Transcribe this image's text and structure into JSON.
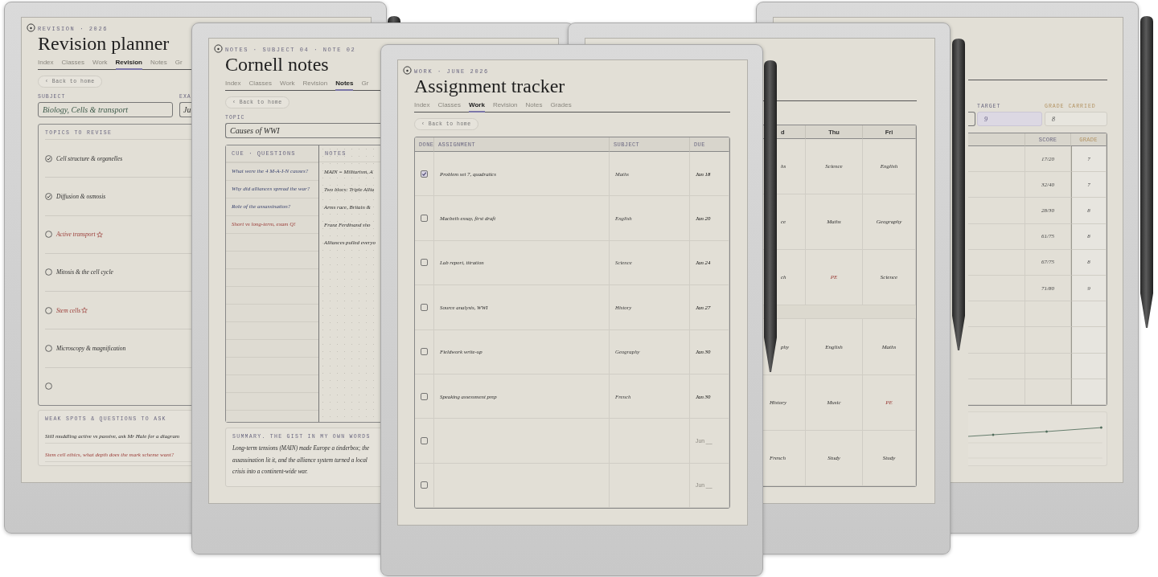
{
  "devices": [
    {
      "kind": "revision",
      "eyebrow": "REVISION · 2026",
      "title": "Revision planner",
      "tabs": [
        {
          "label": "Index",
          "selected": false
        },
        {
          "label": "Classes",
          "selected": false
        },
        {
          "label": "Work",
          "selected": false
        },
        {
          "label": "Revision",
          "selected": true
        },
        {
          "label": "Notes",
          "selected": false
        },
        {
          "label": "Gr",
          "selected": false
        }
      ],
      "back_button": "‹ Back to home",
      "subject": {
        "label": "SUBJECT",
        "value": "Biology, Cells & transport"
      },
      "exam": {
        "label": "EXA",
        "value": "Ju"
      },
      "topics_title": "TOPICS TO REVISE",
      "topics": [
        {
          "text": "Cell structure & organelles",
          "checked": true,
          "starred": false
        },
        {
          "text": "Diffusion & osmosis",
          "checked": true,
          "starred": false
        },
        {
          "text": "Active transport",
          "checked": false,
          "starred": true
        },
        {
          "text": "Mitosis & the cell cycle",
          "checked": false,
          "starred": false
        },
        {
          "text": "Stem cells",
          "checked": false,
          "starred": true
        },
        {
          "text": "Microscopy & magnification",
          "checked": false,
          "starred": false
        },
        {
          "checked": false,
          "starred": false
        }
      ],
      "weak_title": "WEAK SPOTS & QUESTIONS TO ASK",
      "weak_notes": [
        {
          "text": "Still muddling active vs passive, ask Mr Hale for a diagram",
          "flagged": false
        },
        {
          "text": "Stem cell ethics, what depth does the mark scheme want?",
          "flagged": true
        }
      ]
    },
    {
      "kind": "cornell",
      "eyebrow": "NOTES · SUBJECT 04 · NOTE 02",
      "title": "Cornell notes",
      "tabs": [
        {
          "label": "Index",
          "selected": false
        },
        {
          "label": "Classes",
          "selected": false
        },
        {
          "label": "Work",
          "selected": false
        },
        {
          "label": "Revision",
          "selected": false
        },
        {
          "label": "Notes",
          "selected": true
        },
        {
          "label": "Gr",
          "selected": false
        }
      ],
      "back_button": "‹ Back to home",
      "topic": {
        "label": "TOPIC",
        "value": "Causes of WWI"
      },
      "cue_title": "CUE · QUESTIONS",
      "cues": [
        {
          "text": "What were the 4 M-A-I-N causes?",
          "flagged": false
        },
        {
          "text": "Why did alliances spread the war?",
          "flagged": false
        },
        {
          "text": "Role of the assassination?",
          "flagged": false
        },
        {
          "text": "Short vs long-term, exam Q!",
          "flagged": true
        }
      ],
      "notes_title": "NOTES",
      "notes": [
        "MAIN = Militarism, A",
        "Two blocs: Triple Allia",
        "Arms race, Britain &",
        "Franz Ferdinand sho",
        "Alliances pulled everyo"
      ],
      "summary_title": "SUMMARY. THE GIST IN MY OWN WORDS",
      "summary": "Long-term tensions (MAIN) made Europe a tinderbox; the assassination lit it, and the alliance system turned a local crisis into a continent-wide war."
    },
    {
      "kind": "tracker",
      "eyebrow": "WORK · JUNE 2026",
      "title": "Assignment tracker",
      "tabs": [
        {
          "label": "Index",
          "selected": false
        },
        {
          "label": "Classes",
          "selected": false
        },
        {
          "label": "Work",
          "selected": true
        },
        {
          "label": "Revision",
          "selected": false
        },
        {
          "label": "Notes",
          "selected": false
        },
        {
          "label": "Grades",
          "selected": false
        }
      ],
      "back_button": "‹ Back to home",
      "columns": [
        "DONE",
        "ASSIGNMENT",
        "SUBJECT",
        "DUE"
      ],
      "rows": [
        {
          "kind": "filled",
          "done": true,
          "assignment": "Problem set 7, quadratics",
          "subject": "Maths",
          "due": "Jan 18"
        },
        {
          "kind": "filled",
          "done": false,
          "assignment": "Macbeth essay, first draft",
          "subject": "English",
          "due": "Jan 20"
        },
        {
          "kind": "filled",
          "done": false,
          "assignment": "Lab report, titration",
          "subject": "Science",
          "due": "Jan 24"
        },
        {
          "kind": "filled",
          "done": false,
          "assignment": "Source analysis, WWI",
          "subject": "History",
          "due": "Jan 27"
        },
        {
          "kind": "filled",
          "done": false,
          "assignment": "Fieldwork write-up",
          "subject": "Geography",
          "due": "Jan 30"
        },
        {
          "kind": "filled",
          "done": false,
          "assignment": "Speaking assessment prep",
          "subject": "French",
          "due": "Jan 30"
        },
        {
          "kind": "empty",
          "done": false,
          "due": "Jun __"
        },
        {
          "kind": "empty",
          "done": false,
          "due": "Jun __"
        }
      ]
    },
    {
      "kind": "timetable",
      "columns": [
        "d",
        "Thu",
        "Fri"
      ],
      "rows": [
        {
          "kind": "lesson",
          "cells": [
            {
              "text": "hs",
              "flagged": false
            },
            {
              "text": "Science",
              "flagged": false
            },
            {
              "text": "English",
              "flagged": false
            }
          ]
        },
        {
          "kind": "lesson",
          "cells": [
            {
              "text": "ce",
              "flagged": false
            },
            {
              "text": "Maths",
              "flagged": false
            },
            {
              "text": "Geography",
              "flagged": false
            }
          ]
        },
        {
          "kind": "lesson",
          "cells": [
            {
              "text": "ch",
              "flagged": false
            },
            {
              "text": "PE",
              "flagged": true
            },
            {
              "text": "Science",
              "flagged": false
            }
          ]
        },
        {
          "kind": "break"
        },
        {
          "kind": "lesson",
          "cells": [
            {
              "text": "phy",
              "flagged": false
            },
            {
              "text": "English",
              "flagged": false
            },
            {
              "text": "Maths",
              "flagged": false
            }
          ]
        },
        {
          "kind": "lesson",
          "cells": [
            {
              "text": "History",
              "flagged": false
            },
            {
              "text": "Music",
              "flagged": false
            },
            {
              "text": "PE",
              "flagged": true
            }
          ]
        },
        {
          "kind": "lesson",
          "cells": [
            {
              "text": "French",
              "flagged": false
            },
            {
              "text": "Study",
              "flagged": false
            },
            {
              "text": "Study",
              "flagged": false
            }
          ]
        }
      ]
    },
    {
      "kind": "grades",
      "fields": [
        {
          "label": "TARGET",
          "value": "9",
          "kind": "target"
        },
        {
          "label": "GRADE CARRIED",
          "value": "8",
          "kind": "carried"
        }
      ],
      "columns": [
        {
          "label": "SCORE",
          "kind": "score"
        },
        {
          "label": "GRADE",
          "kind": "grade"
        }
      ],
      "rows": [
        {
          "score": "17/20",
          "grade": "7"
        },
        {
          "score": "32/40",
          "grade": "7"
        },
        {
          "score": "28/30",
          "grade": "8"
        },
        {
          "score": "61/75",
          "grade": "8"
        },
        {
          "score": "67/75",
          "grade": "8"
        },
        {
          "score": "71/80",
          "grade": "9"
        }
      ]
    }
  ]
}
